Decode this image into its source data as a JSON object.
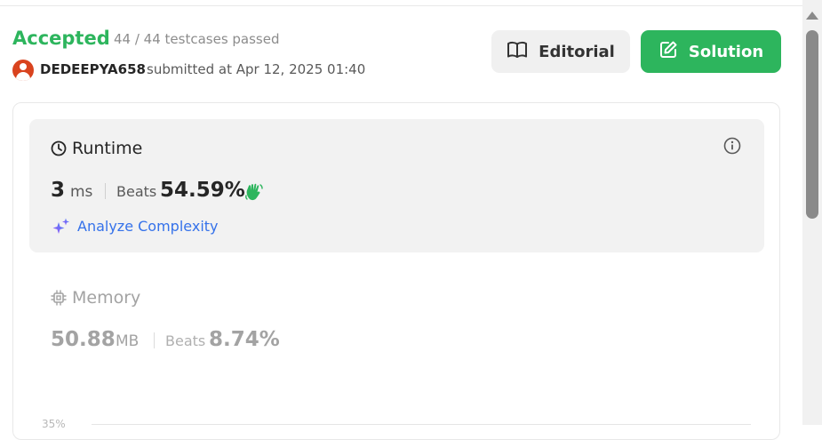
{
  "result": {
    "status": "Accepted",
    "testcases": "44 / 44 testcases passed",
    "username": "DEDEEPYA658",
    "submitted_text": "submitted at Apr 12, 2025 01:40"
  },
  "buttons": {
    "editorial": "Editorial",
    "solution": "Solution"
  },
  "runtime": {
    "title": "Runtime",
    "value": "3",
    "unit": "ms",
    "beats_label": "Beats",
    "beats_value": "54.59%",
    "analyze_label": "Analyze Complexity"
  },
  "memory": {
    "title": "Memory",
    "value": "50.88",
    "unit": "MB",
    "beats_label": "Beats",
    "beats_value": "8.74%"
  },
  "chart": {
    "first_tick": "35%"
  },
  "colors": {
    "accepted": "#2db55d",
    "solution_button": "#2db55d",
    "link": "#3572ea",
    "avatar": "#d9431e"
  },
  "icons": [
    "book-icon",
    "edit-icon",
    "clock-icon",
    "info-icon",
    "wave-hand-icon",
    "sparkle-icon",
    "chip-icon"
  ]
}
